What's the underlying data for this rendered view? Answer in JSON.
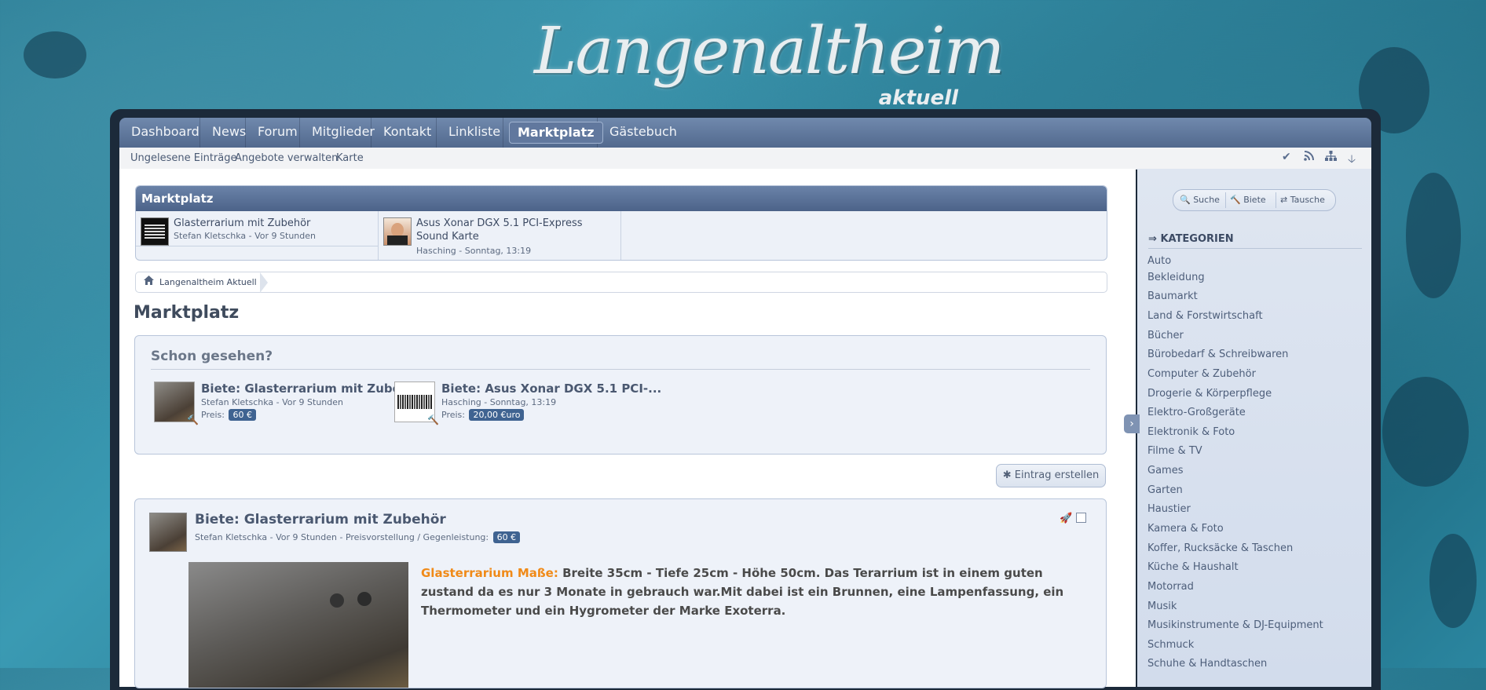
{
  "logo": {
    "title": "Langenaltheim",
    "subtitle": "aktuell"
  },
  "nav": {
    "tabs": [
      "Dashboard",
      "News",
      "Forum",
      "Mitglieder",
      "Kontakt",
      "Linkliste",
      "Marktplatz",
      "Gästebuch"
    ],
    "active": "Marktplatz"
  },
  "subnav": {
    "links": [
      "Ungelesene Einträge",
      "Angebote verwalten",
      "Karte"
    ],
    "icons": [
      "check-icon",
      "rss-icon",
      "sitemap-icon",
      "arrow-down-icon"
    ]
  },
  "marketplace_widget": {
    "title": "Marktplatz",
    "items": [
      {
        "title": "Glasterrarium mit Zubehör",
        "meta": "Stefan Kletschka - Vor 9 Stunden"
      },
      {
        "title": "Asus Xonar DGX 5.1 PCI-Express Sound Karte",
        "meta": "Hasching - Sonntag, 13:19"
      }
    ]
  },
  "breadcrumb": {
    "home": "Langenaltheim Aktuell"
  },
  "page_title": "Marktplatz",
  "seen": {
    "title": "Schon gesehen?",
    "price_label": "Preis:",
    "items": [
      {
        "title": "Biete: Glasterrarium mit Zubehör",
        "meta": "Stefan Kletschka - Vor 9 Stunden",
        "price": "60 €"
      },
      {
        "title": "Biete: Asus Xonar DGX 5.1 PCI-...",
        "meta": "Hasching - Sonntag, 13:19",
        "price": "20,00 €uro"
      }
    ]
  },
  "create_button": "Eintrag erstellen",
  "entry": {
    "title": "Biete: Glasterrarium mit Zubehör",
    "meta": "Stefan Kletschka - Vor 9 Stunden - Preisvorstellung / Gegenleistung:",
    "price": "60 €",
    "highlight": "Glasterrarium Maße:",
    "text": "Breite 35cm - Tiefe 25cm - Höhe 50cm. Das Terarrium ist in einem guten zustand da es nur 3 Monate in gebrauch war.Mit dabei ist ein Brunnen, eine Lampenfassung, ein Thermometer und ein Hygrometer der Marke Exoterra."
  },
  "sidebar": {
    "actions": [
      "Suche",
      "Biete",
      "Tausche"
    ],
    "categories_title": "KATEGORIEN",
    "categories": [
      "Auto",
      "Bekleidung",
      "Baumarkt",
      "Land & Forstwirtschaft",
      "Bücher",
      "Bürobedarf & Schreibwaren",
      "Computer & Zubehör",
      "Drogerie & Körperpflege",
      "Elektro-Großgeräte",
      "Elektronik & Foto",
      "Filme & TV",
      "Games",
      "Garten",
      "Haustier",
      "Kamera & Foto",
      "Koffer, Rucksäcke & Taschen",
      "Küche & Haushalt",
      "Motorrad",
      "Musik",
      "Musikinstrumente & DJ-Equipment",
      "Schmuck",
      "Schuhe & Handtaschen"
    ]
  }
}
